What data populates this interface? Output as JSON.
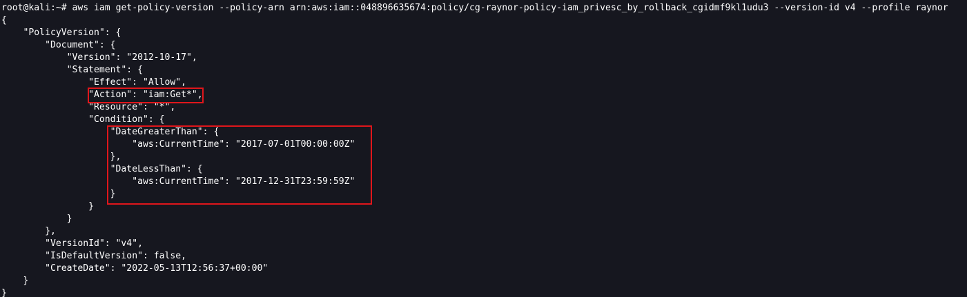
{
  "terminal": {
    "prompt": "root@kali:~#",
    "command": "aws iam get-policy-version --policy-arn arn:aws:iam::048896635674:policy/cg-raynor-policy-iam_privesc_by_rollback_cgidmf9kl1udu3 --version-id v4 --profile raynor",
    "output_lines": [
      "{",
      "    \"PolicyVersion\": {",
      "        \"Document\": {",
      "            \"Version\": \"2012-10-17\",",
      "            \"Statement\": {",
      "                \"Effect\": \"Allow\",",
      "                \"Action\": \"iam:Get*\",",
      "                \"Resource\": \"*\",",
      "                \"Condition\": {",
      "                    \"DateGreaterThan\": {",
      "                        \"aws:CurrentTime\": \"2017-07-01T00:00:00Z\"",
      "                    },",
      "                    \"DateLessThan\": {",
      "                        \"aws:CurrentTime\": \"2017-12-31T23:59:59Z\"",
      "                    }",
      "                }",
      "            }",
      "        },",
      "        \"VersionId\": \"v4\",",
      "        \"IsDefaultVersion\": false,",
      "        \"CreateDate\": \"2022-05-13T12:56:37+00:00\"",
      "    }",
      "}"
    ]
  },
  "colors": {
    "background": "#16171f",
    "text": "#ffffff",
    "highlight_box": "#e0161b"
  }
}
